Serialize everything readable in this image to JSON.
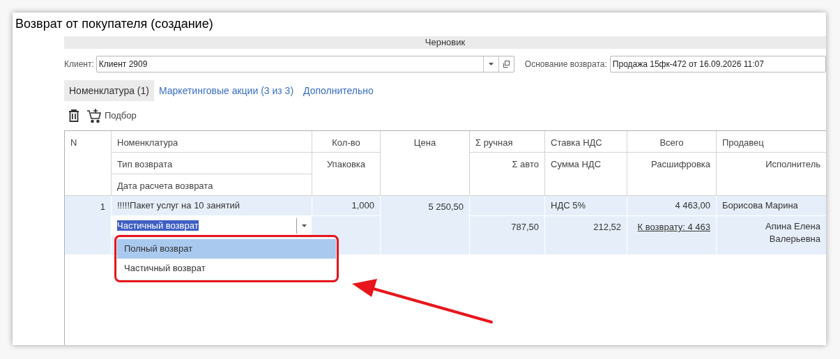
{
  "window": {
    "title": "Возврат от покупателя (создание)"
  },
  "status": "Черновик",
  "client": {
    "label": "Клиент:",
    "value": "Клиент 2909"
  },
  "basis": {
    "label": "Основание возврата:",
    "value": "Продажа 15фк-472 от 16.09.2026 11:07"
  },
  "tabs": [
    {
      "label": "Номенклатура (1)",
      "selected": true
    },
    {
      "label": "Маркетинговые акции (3 из 3)",
      "selected": false
    },
    {
      "label": "Дополнительно",
      "selected": false
    }
  ],
  "toolbar": {
    "pick_label": "Подбор"
  },
  "table": {
    "columns": [
      {
        "line_1": "N"
      },
      {
        "line_1": "Номенклатура",
        "line_2": "Тип возврата",
        "line_3": "Дата расчета возврата"
      },
      {
        "line_1": "Кол-во",
        "line_2": "Упаковка"
      },
      {
        "line_1": "Цена"
      },
      {
        "line_1": "Σ ручная",
        "line_2": "Σ авто"
      },
      {
        "line_1": "Ставка НДС",
        "line_2": "Сумма НДС"
      },
      {
        "line_1": "Всего",
        "line_2": "Расшифровка"
      },
      {
        "line_1": "Продавец",
        "line_2": "Исполнитель"
      }
    ],
    "rows": [
      {
        "selected": true,
        "number": "1",
        "nomenclature": "!!!!!Пакет услуг на 10 занятий",
        "return_type": "Частичный возврат",
        "quantity": "1,000",
        "price": "5 250,50",
        "sum_auto": "787,50",
        "vat_rate": "НДС 5%",
        "vat_sum": "212,52",
        "total": "4 463,00",
        "breakdown": "К возврату: 4 463",
        "seller": "Борисова Марина",
        "executor": "Апина Елена Валерьевна"
      }
    ]
  },
  "dropdown": {
    "options": [
      {
        "label": "Полный возврат",
        "selected": true
      },
      {
        "label": "Частичный возврат",
        "selected": false
      }
    ]
  }
}
